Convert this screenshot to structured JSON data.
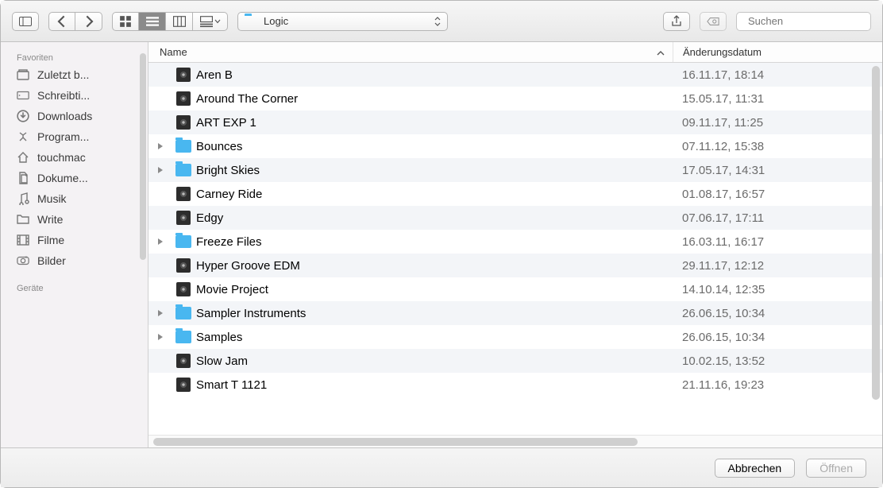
{
  "path_selector": {
    "label": "Logic"
  },
  "search": {
    "placeholder": "Suchen"
  },
  "sidebar": {
    "headings": {
      "favorites": "Favoriten",
      "devices": "Geräte"
    },
    "favorites": [
      {
        "label": "Zuletzt b...",
        "icon": "recent"
      },
      {
        "label": "Schreibti...",
        "icon": "desktop"
      },
      {
        "label": "Downloads",
        "icon": "downloads"
      },
      {
        "label": "Program...",
        "icon": "apps"
      },
      {
        "label": "touchmac",
        "icon": "home"
      },
      {
        "label": "Dokume...",
        "icon": "documents"
      },
      {
        "label": "Musik",
        "icon": "music"
      },
      {
        "label": "Write",
        "icon": "folder"
      },
      {
        "label": "Filme",
        "icon": "movies"
      },
      {
        "label": "Bilder",
        "icon": "pictures"
      }
    ]
  },
  "columns": {
    "name": "Name",
    "date": "Änderungsdatum"
  },
  "rows": [
    {
      "kind": "file",
      "name": "Aren B",
      "date": "16.11.17, 18:14"
    },
    {
      "kind": "file",
      "name": "Around The Corner",
      "date": "15.05.17, 11:31"
    },
    {
      "kind": "file",
      "name": "ART EXP 1",
      "date": "09.11.17, 11:25"
    },
    {
      "kind": "folder",
      "name": "Bounces",
      "date": "07.11.12, 15:38"
    },
    {
      "kind": "folder",
      "name": "Bright Skies",
      "date": "17.05.17, 14:31"
    },
    {
      "kind": "file",
      "name": "Carney Ride",
      "date": "01.08.17, 16:57"
    },
    {
      "kind": "file",
      "name": "Edgy",
      "date": "07.06.17, 17:11"
    },
    {
      "kind": "folder",
      "name": "Freeze Files",
      "date": "16.03.11, 16:17"
    },
    {
      "kind": "file",
      "name": "Hyper Groove EDM",
      "date": "29.11.17, 12:12"
    },
    {
      "kind": "file",
      "name": "Movie Project",
      "date": "14.10.14, 12:35"
    },
    {
      "kind": "folder",
      "name": "Sampler Instruments",
      "date": "26.06.15, 10:34"
    },
    {
      "kind": "folder",
      "name": "Samples",
      "date": "26.06.15, 10:34"
    },
    {
      "kind": "file",
      "name": "Slow Jam",
      "date": "10.02.15, 13:52"
    },
    {
      "kind": "file",
      "name": "Smart T 1121",
      "date": "21.11.16, 19:23"
    }
  ],
  "footer": {
    "cancel": "Abbrechen",
    "open": "Öffnen"
  }
}
